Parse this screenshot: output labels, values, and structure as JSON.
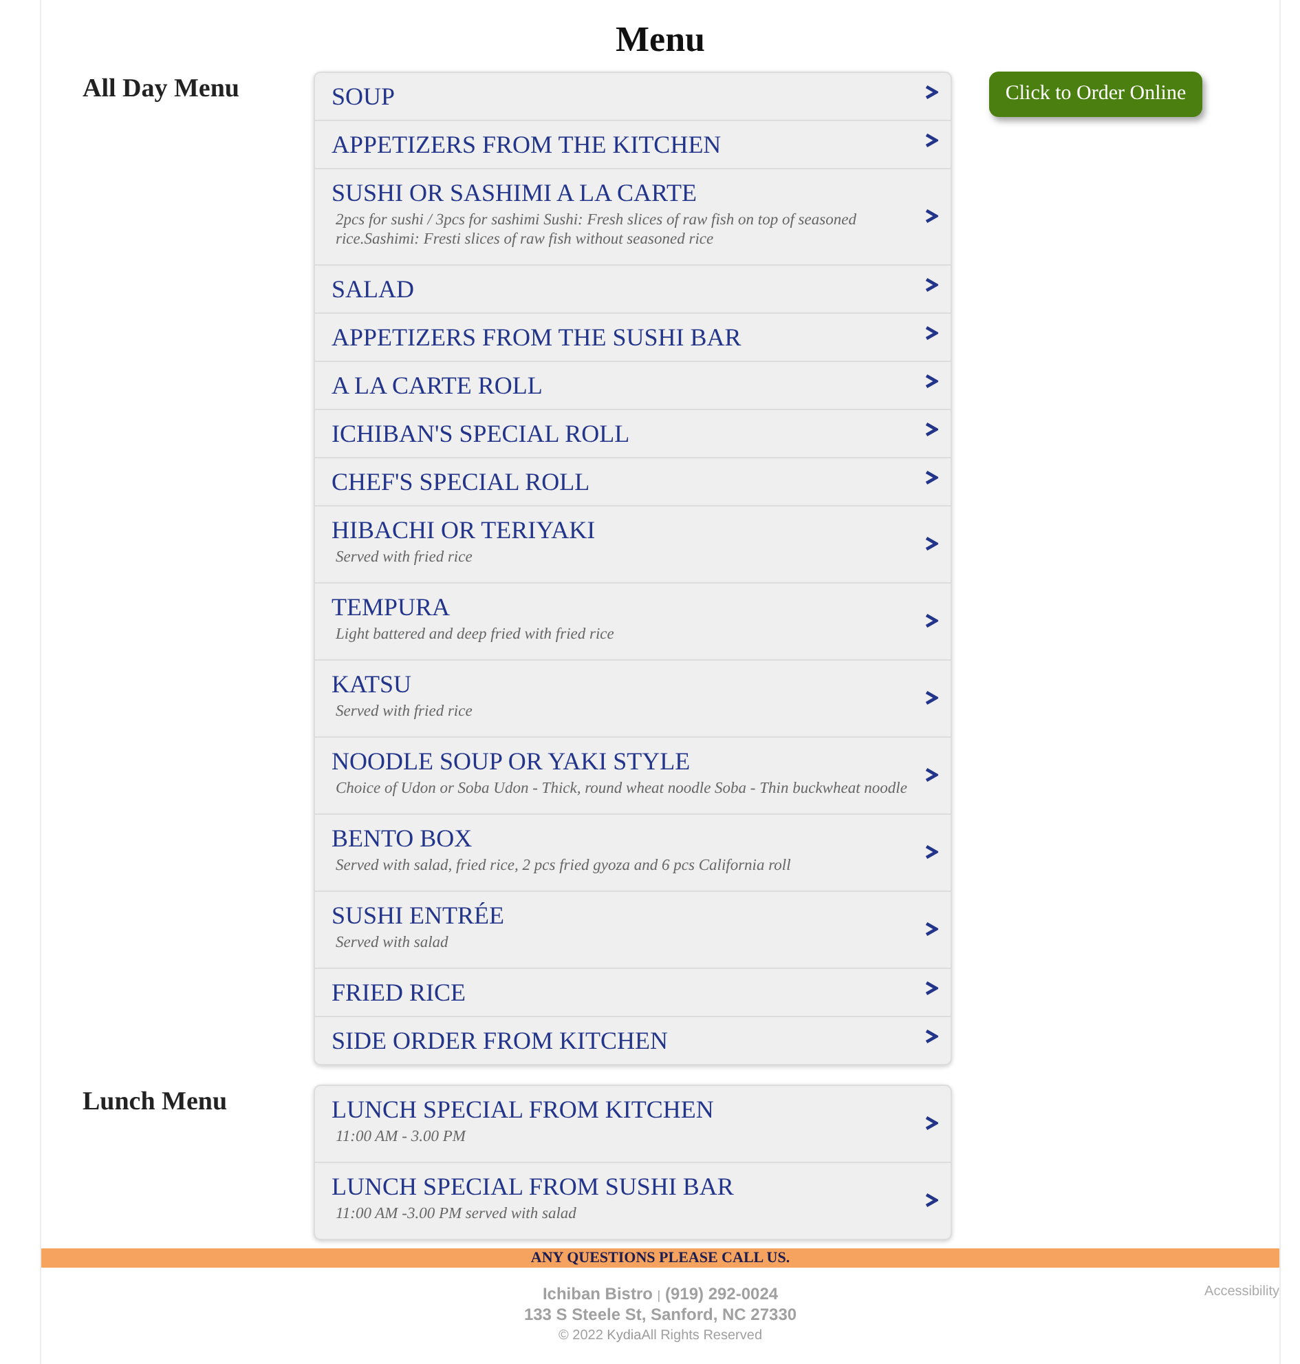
{
  "title": "Menu",
  "sections": [
    {
      "title": "All Day Menu",
      "items": [
        {
          "name": "SOUP"
        },
        {
          "name": "APPETIZERS FROM THE KITCHEN"
        },
        {
          "name": "SUSHI OR SASHIMI A LA CARTE",
          "description": "2pcs for sushi / 3pcs for sashimi Sushi: Fresh slices of raw fish on top of seasoned rice.Sashimi: Fresti slices of raw fish without seasoned rice"
        },
        {
          "name": "SALAD"
        },
        {
          "name": "APPETIZERS FROM THE SUSHI BAR"
        },
        {
          "name": "A LA CARTE ROLL"
        },
        {
          "name": "ICHIBAN'S SPECIAL ROLL"
        },
        {
          "name": "CHEF'S SPECIAL ROLL"
        },
        {
          "name": "HIBACHI OR TERIYAKI",
          "description": "Served with fried rice"
        },
        {
          "name": "TEMPURA",
          "description": "Light battered and deep fried with fried rice"
        },
        {
          "name": "KATSU",
          "description": "Served with fried rice"
        },
        {
          "name": "NOODLE SOUP OR YAKI STYLE",
          "description": "Choice of Udon or Soba Udon - Thick, round wheat noodle Soba - Thin buckwheat noodle"
        },
        {
          "name": "BENTO BOX",
          "description": "Served with salad, fried rice, 2 pcs fried gyoza and 6 pcs California roll"
        },
        {
          "name": "SUSHI ENTRÉE",
          "description": "Served with salad"
        },
        {
          "name": "FRIED RICE"
        },
        {
          "name": "SIDE ORDER FROM KITCHEN"
        }
      ]
    },
    {
      "title": "Lunch Menu",
      "items": [
        {
          "name": "LUNCH SPECIAL FROM KITCHEN",
          "description": "11:00 AM - 3.00 PM"
        },
        {
          "name": "LUNCH SPECIAL FROM SUSHI BAR",
          "description": "11:00 AM -3.00 PM served with salad"
        }
      ]
    }
  ],
  "order_button": "Click to Order Online",
  "footer": {
    "notice": "ANY QUESTIONS PLEASE CALL US.",
    "business": "Ichiban Bistro",
    "separator": "|",
    "phone": "(919) 292-0024",
    "address": "133 S Steele St, Sanford, NC 27330",
    "copyright": "© 2022",
    "brand": "Kydia",
    "rights": "All Rights Reserved",
    "accessibility": "Accessibility"
  }
}
